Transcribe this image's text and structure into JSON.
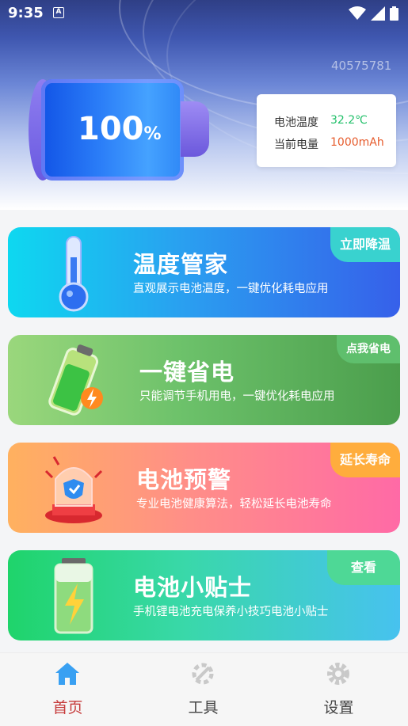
{
  "status_bar": {
    "time": "9:35",
    "a_badge": "A"
  },
  "header": {
    "device_id": "40575781",
    "battery_percent": "100",
    "percent_sign": "%",
    "info": {
      "temp_label": "电池温度",
      "temp_value": "32.2℃",
      "capacity_label": "当前电量",
      "capacity_value": "1000mAh"
    }
  },
  "cards": [
    {
      "title": "温度管家",
      "desc": "直观展示电池温度，一键优化耗电应用",
      "pill": "立即降温",
      "icon": "thermometer-icon"
    },
    {
      "title": "一键省电",
      "desc": "只能调节手机用电，一键优化耗电应用",
      "pill": "点我省电",
      "icon": "battery-charging-icon"
    },
    {
      "title": "电池预警",
      "desc": "专业电池健康算法，轻松延长电池寿命",
      "pill": "延长寿命",
      "icon": "alarm-shield-icon"
    },
    {
      "title": "电池小贴士",
      "desc": "手机锂电池充电保养小技巧电池小贴士",
      "pill": "查看",
      "icon": "battery-bolt-icon"
    }
  ],
  "nav": [
    {
      "label": "首页",
      "icon": "home-icon",
      "active": true
    },
    {
      "label": "工具",
      "icon": "tools-icon",
      "active": false
    },
    {
      "label": "设置",
      "icon": "gear-icon",
      "active": false
    }
  ],
  "colors": {
    "active_nav": "#c63a3a",
    "temp_value": "#22c06a",
    "capacity_value": "#e65b2c"
  }
}
